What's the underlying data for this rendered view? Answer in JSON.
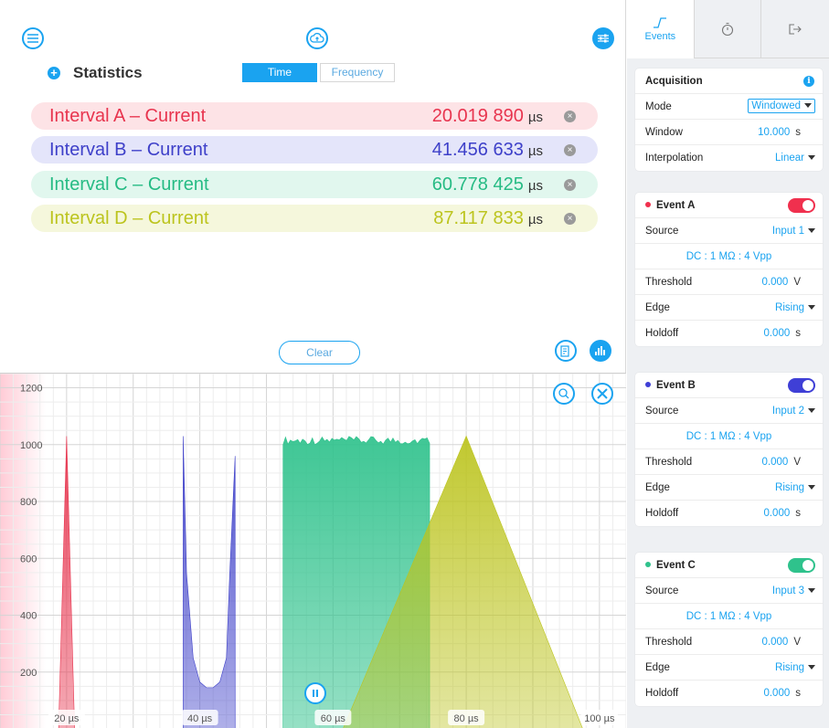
{
  "statistics": {
    "title": "Statistics",
    "mode_tabs": [
      "Time",
      "Frequency"
    ],
    "clear_label": "Clear",
    "intervals": [
      {
        "label": "Interval A – Current",
        "value": "20.019 890",
        "unit": "µs",
        "label_color": "#e8344e",
        "bg": "#fde3e6"
      },
      {
        "label": "Interval B – Current",
        "value": "41.456 633",
        "unit": "µs",
        "label_color": "#3e40c9",
        "bg": "#e4e5fa"
      },
      {
        "label": "Interval C – Current",
        "value": "60.778 425",
        "unit": "µs",
        "label_color": "#26bb84",
        "bg": "#e1f7ee"
      },
      {
        "label": "Interval D – Current",
        "value": "87.117 833",
        "unit": "µs",
        "label_color": "#bcc41e",
        "bg": "#f5f7dc"
      }
    ]
  },
  "tabs": [
    {
      "icon": "edge-icon",
      "label": "Events"
    },
    {
      "icon": "stopwatch-icon",
      "label": ""
    },
    {
      "icon": "export-icon",
      "label": ""
    }
  ],
  "acquisition": {
    "title": "Acquisition",
    "mode_label": "Mode",
    "mode_value": "Windowed",
    "window_label": "Window",
    "window_value": "10.000",
    "window_unit": "s",
    "interpolation_label": "Interpolation",
    "interpolation_value": "Linear"
  },
  "events": [
    {
      "name": "Event A",
      "color": "#f0304e",
      "enabled": true,
      "source_label": "Source",
      "source": "Input 1",
      "coupling": "DC : 1 MΩ : 4 Vpp",
      "threshold_label": "Threshold",
      "threshold": "0.000",
      "threshold_unit": "V",
      "edge_label": "Edge",
      "edge": "Rising",
      "holdoff_label": "Holdoff",
      "holdoff": "0.000",
      "holdoff_unit": "s"
    },
    {
      "name": "Event B",
      "color": "#3f3fd6",
      "enabled": true,
      "source_label": "Source",
      "source": "Input 2",
      "coupling": "DC : 1 MΩ : 4 Vpp",
      "threshold_label": "Threshold",
      "threshold": "0.000",
      "threshold_unit": "V",
      "edge_label": "Edge",
      "edge": "Rising",
      "holdoff_label": "Holdoff",
      "holdoff": "0.000",
      "holdoff_unit": "s"
    },
    {
      "name": "Event C",
      "color": "#2fc28c",
      "enabled": true,
      "source_label": "Source",
      "source": "Input 3",
      "coupling": "DC : 1 MΩ : 4 Vpp",
      "threshold_label": "Threshold",
      "threshold": "0.000",
      "threshold_unit": "V",
      "edge_label": "Edge",
      "edge": "Rising",
      "holdoff_label": "Holdoff",
      "holdoff": "0.000",
      "holdoff_unit": "s"
    }
  ],
  "colors": {
    "accent": "#1aa3f0"
  },
  "chart_data": {
    "type": "area",
    "xlim": [
      10,
      104
    ],
    "ylim": [
      0,
      1250
    ],
    "x_ticks": [
      20,
      40,
      60,
      80,
      100
    ],
    "x_tick_labels": [
      "20 µs",
      "40 µs",
      "60 µs",
      "80 µs",
      "100 µs"
    ],
    "y_ticks": [
      200,
      400,
      600,
      800,
      1000,
      1200
    ],
    "y_tick_labels": [
      "200",
      "400",
      "600",
      "800",
      "1000",
      "1200"
    ],
    "grid": true,
    "series": [
      {
        "color": "#e8344e",
        "shape": "triangle",
        "x": [
          18.8,
          20.0,
          21.2
        ],
        "y": [
          0,
          1030,
          0
        ]
      },
      {
        "color": "#3e40c9",
        "shape": "u-shape",
        "x": [
          37.5,
          38.0,
          39.0,
          40.0,
          41.0,
          42.0,
          43.0,
          44.0,
          44.5,
          45.3
        ],
        "y": [
          1030,
          550,
          250,
          165,
          145,
          145,
          165,
          250,
          550,
          960
        ]
      },
      {
        "color": "#2fc28c",
        "shape": "uniform",
        "x": [
          52.5,
          74.5
        ],
        "y": [
          1000,
          1000
        ]
      },
      {
        "color": "#bcc41e",
        "shape": "triangle",
        "x": [
          61.5,
          80.0,
          97.5
        ],
        "y": [
          0,
          1030,
          0
        ]
      }
    ]
  }
}
